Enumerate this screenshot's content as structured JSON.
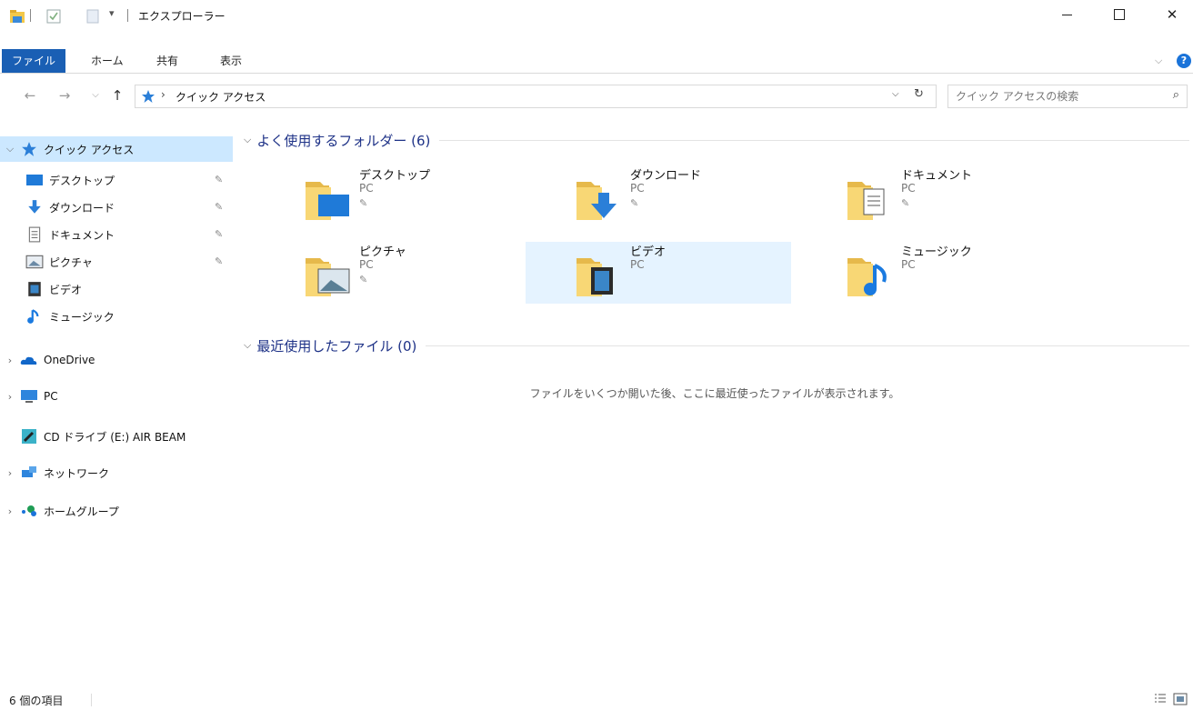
{
  "window": {
    "title": "エクスプローラー",
    "minimize_glyph": "—",
    "maximize_glyph": "☐",
    "close_glyph": "✕"
  },
  "ribbon": {
    "tabs": [
      "ファイル",
      "ホーム",
      "共有",
      "表示"
    ]
  },
  "address": {
    "breadcrumb_sep": "›",
    "location": "クイック アクセス",
    "search_placeholder": "クイック アクセスの検索"
  },
  "nav_pane": {
    "quick_access": "クイック アクセス",
    "pinned": [
      {
        "label": "デスクトップ",
        "icon": "desktop-icon",
        "pinned": true
      },
      {
        "label": "ダウンロード",
        "icon": "download-icon",
        "pinned": true
      },
      {
        "label": "ドキュメント",
        "icon": "document-icon",
        "pinned": true
      },
      {
        "label": "ピクチャ",
        "icon": "picture-icon",
        "pinned": true
      },
      {
        "label": "ビデオ",
        "icon": "video-icon",
        "pinned": false
      },
      {
        "label": "ミュージック",
        "icon": "music-icon",
        "pinned": false
      }
    ],
    "onedrive": "OneDrive",
    "pc": "PC",
    "cd_drive": "CD ドライブ (E:) AIR BEAM",
    "network": "ネットワーク",
    "homegroup": "ホームグループ"
  },
  "content": {
    "frequent_header": "よく使用するフォルダー (6)",
    "recent_header": "最近使用したファイル (0)",
    "folders": [
      {
        "name": "デスクトップ",
        "location": "PC",
        "pinned": true
      },
      {
        "name": "ダウンロード",
        "location": "PC",
        "pinned": true
      },
      {
        "name": "ドキュメント",
        "location": "PC",
        "pinned": true
      },
      {
        "name": "ピクチャ",
        "location": "PC",
        "pinned": true
      },
      {
        "name": "ビデオ",
        "location": "PC",
        "pinned": false
      },
      {
        "name": "ミュージック",
        "location": "PC",
        "pinned": false
      }
    ],
    "empty_message": "ファイルをいくつか開いた後、ここに最近使ったファイルが表示されます。"
  },
  "status": {
    "item_count": "6 個の項目"
  },
  "colors": {
    "accent": "#1a5fb4",
    "folder": "#f8d775",
    "folder_dark": "#e6b94b",
    "selected": "#cce8ff",
    "hover": "#e5f3ff",
    "group_header": "#1e3287"
  }
}
